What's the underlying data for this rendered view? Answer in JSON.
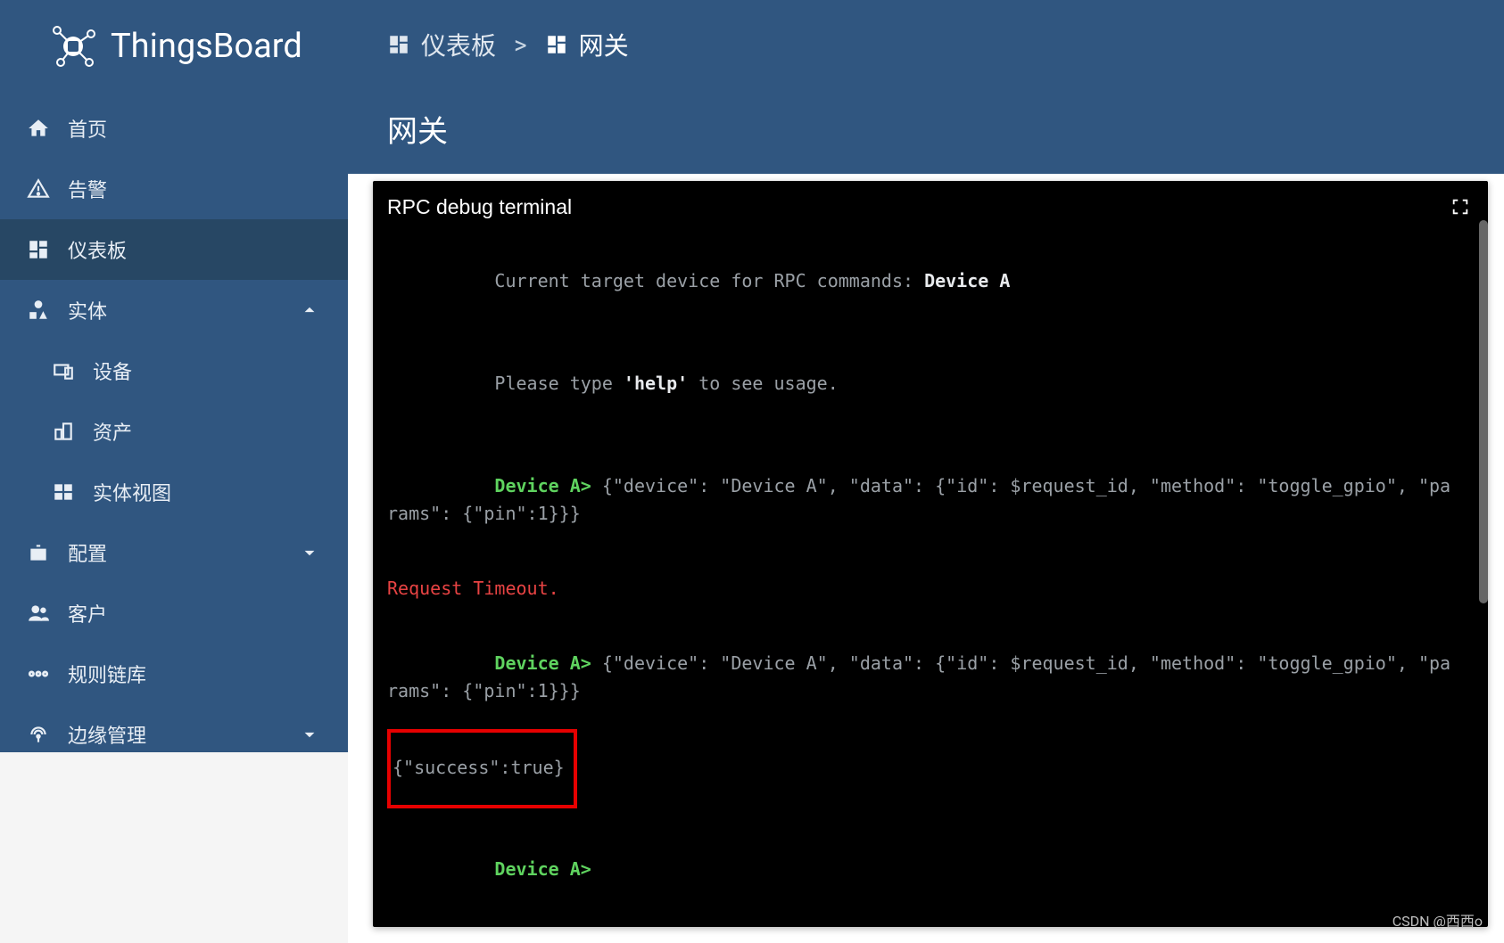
{
  "brand": "ThingsBoard",
  "sidebar": {
    "home": "首页",
    "alarms": "告警",
    "dashboards": "仪表板",
    "entities": "实体",
    "devices": "设备",
    "assets": "资产",
    "entity_views": "实体视图",
    "settings": "配置",
    "customers": "客户",
    "rule_chains": "规则链库",
    "edge": "边缘管理"
  },
  "breadcrumb": {
    "dashboards": "仪表板",
    "sep": ">",
    "gateway": "网关"
  },
  "page_title": "网关",
  "terminal": {
    "title": "RPC debug terminal",
    "target_prefix": "Current target device for RPC commands: ",
    "target_device": "Device A",
    "help_prefix": "Please type ",
    "help_cmd": "'help'",
    "help_suffix": " to see usage.",
    "prompt": "Device A",
    "prompt_sym": ">",
    "cmd1": " {\"device\": \"Device A\", \"data\": {\"id\": $request_id, \"method\": \"toggle_gpio\", \"params\": {\"pin\":1}}}",
    "timeout": "Request Timeout.",
    "cmd2": " {\"device\": \"Device A\", \"data\": {\"id\": $request_id, \"method\": \"toggle_gpio\", \"params\": {\"pin\":1}}}",
    "success": "{\"success\":true}"
  },
  "watermark": "CSDN @西西o"
}
